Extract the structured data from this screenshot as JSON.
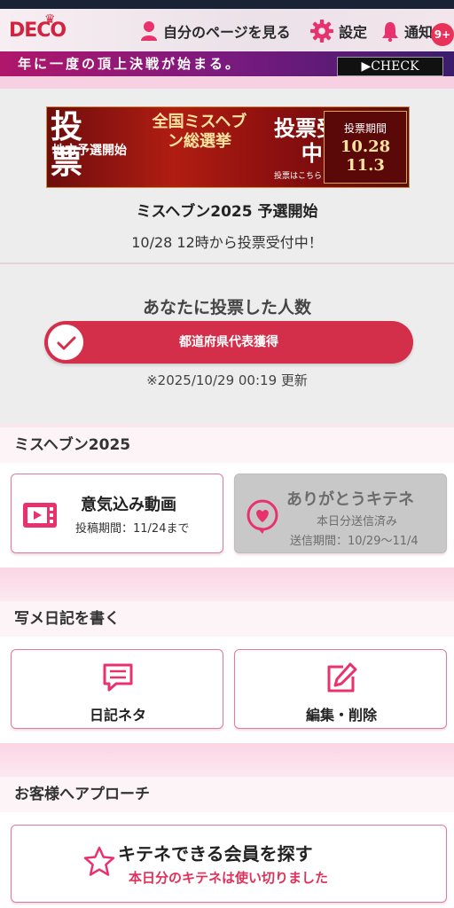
{
  "header": {
    "logo": "DECO",
    "mypage_label": "自分のページを見る",
    "settings_label": "設定",
    "notify_label": "通知",
    "notify_badge": "9+"
  },
  "banner_strip": {
    "text": "年に一度の頂上決戦が始まる。",
    "check_label": "▶CHECK"
  },
  "promo": {
    "image": {
      "big_text": "投票",
      "sub_text": "地方予選開始",
      "center_text": "全国ミスヘブン総選挙",
      "vote_text": "投票受付中!",
      "vote_small": "投票はこちら",
      "period_title": "投票期間",
      "period_start": "10.28",
      "period_end": "11.3"
    },
    "title": "ミスヘブン2025 予選開始",
    "description": "10/28 12時から投票受付中！"
  },
  "votes": {
    "heading": "あなたに投票した人数",
    "status_label": "都道府県代表獲得",
    "updated": "※2025/10/29 00:19 更新"
  },
  "sections": {
    "miss_heaven": {
      "title": "ミスヘブン2025",
      "video_card": {
        "title": "意気込み動画",
        "sub": "投稿期間：11/24まで"
      },
      "thanks_card": {
        "title": "ありがとうキテネ",
        "sub1": "本日分送信済み",
        "sub2": "送信期間：10/29〜11/4"
      }
    },
    "diary": {
      "title": "写メ日記を書く",
      "topics_label": "日記ネタ",
      "edit_label": "編集・削除"
    },
    "approach": {
      "title": "お客様へアプローチ",
      "search_label": "キテネできる会員を探す",
      "search_note": "本日分のキテネは使い切りました"
    }
  },
  "colors": {
    "accent": "#d42f4a",
    "card_border": "#e07a9c",
    "note_red": "#e0305a",
    "icon_pink": "#e8326e"
  }
}
